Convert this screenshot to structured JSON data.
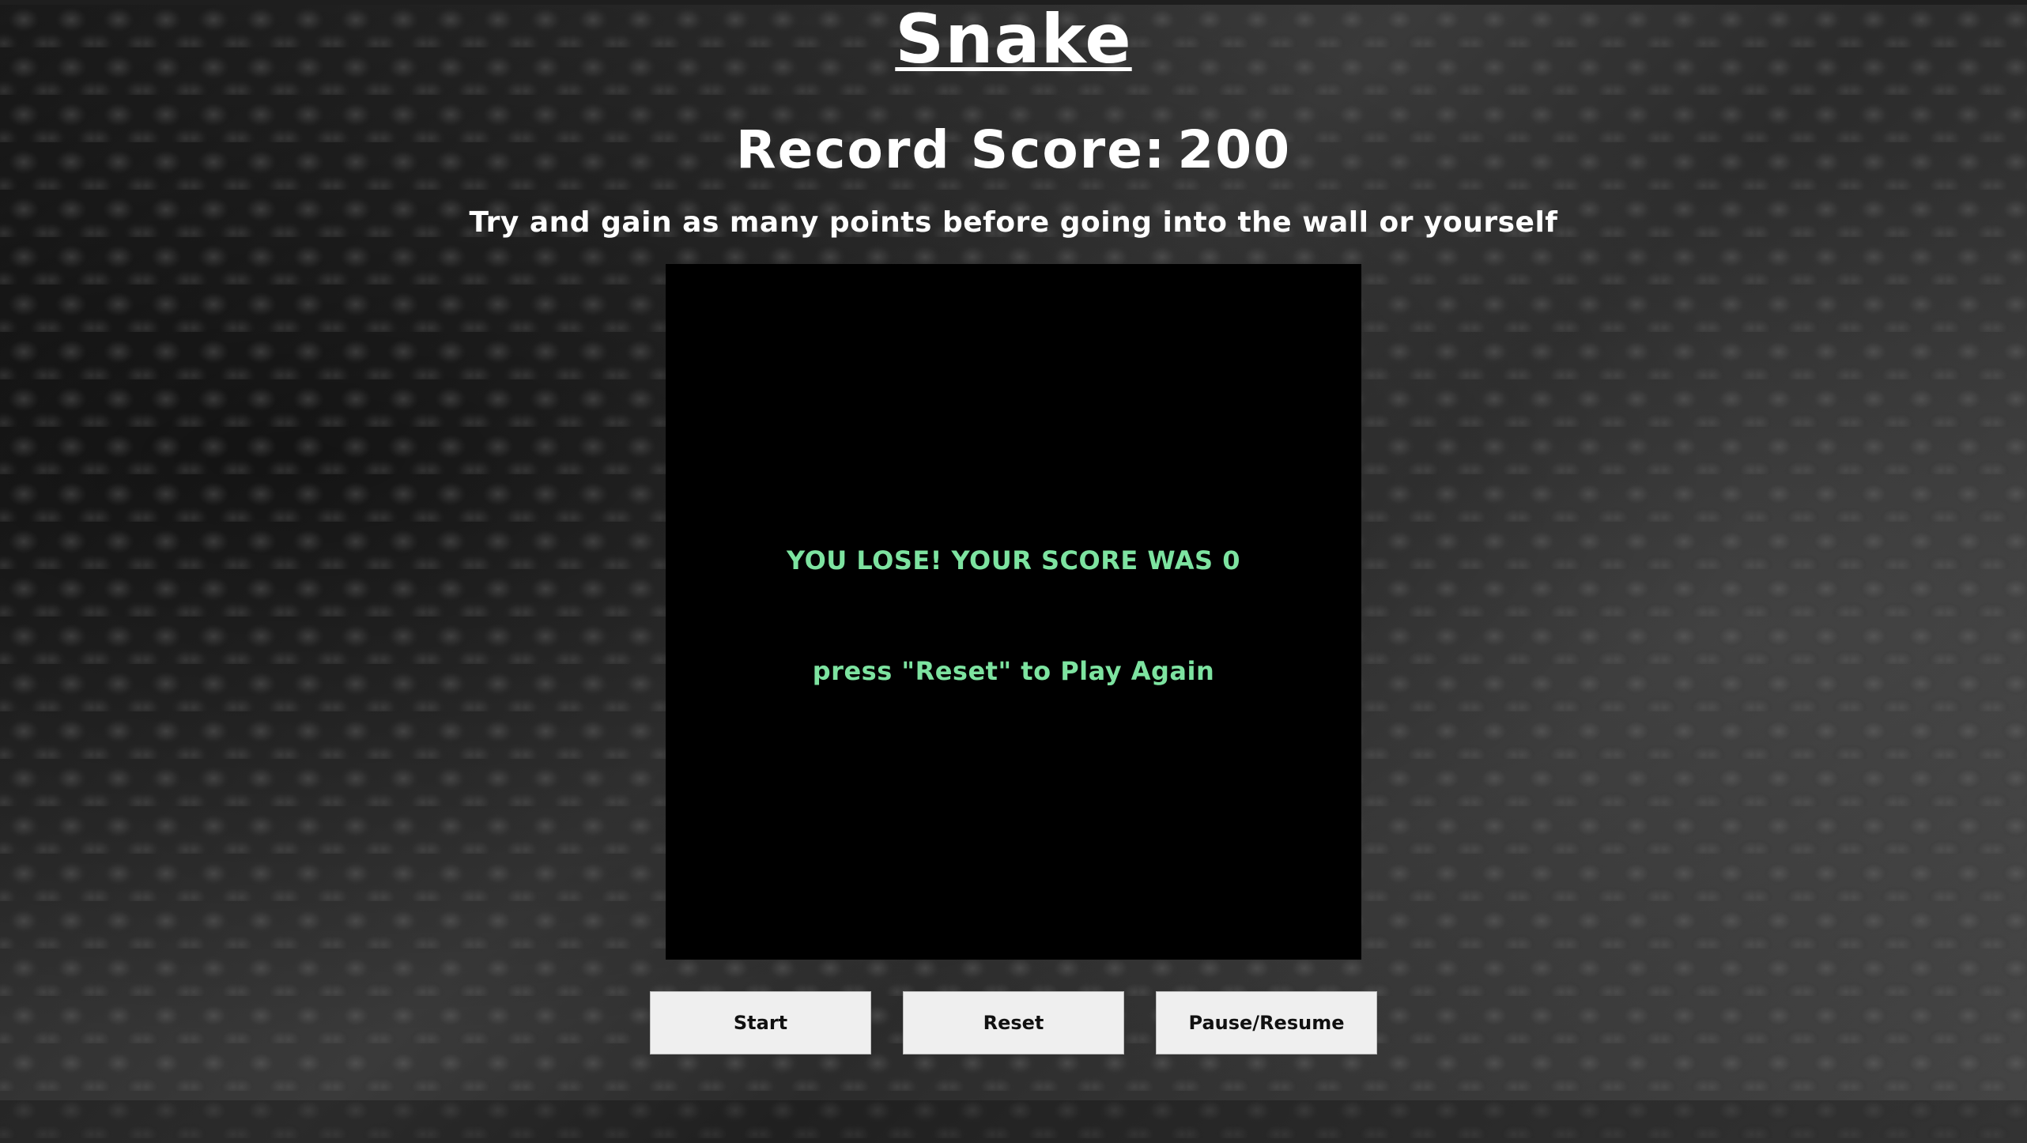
{
  "header": {
    "title": "Snake",
    "record_label": "Record Score:",
    "record_value": "200",
    "instructions": "Try and gain as many points before going into the wall or yourself"
  },
  "board": {
    "lose_message": "YOU LOSE! YOUR SCORE WAS 0",
    "reset_hint": "press \"Reset\" to Play Again",
    "background_color": "#000000",
    "text_color": "#7de3a0"
  },
  "controls": {
    "start_label": "Start",
    "reset_label": "Reset",
    "pause_label": "Pause/Resume"
  }
}
